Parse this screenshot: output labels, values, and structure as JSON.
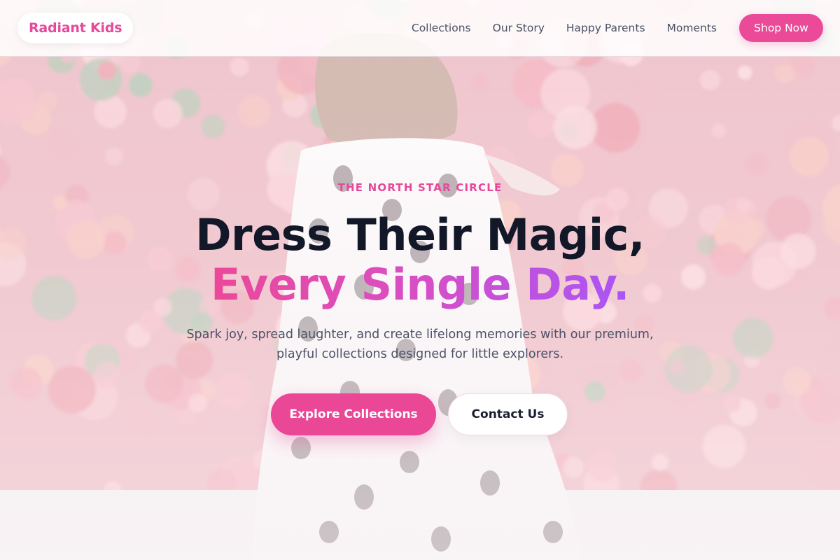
{
  "brand": {
    "name": "Radiant Kids"
  },
  "nav": {
    "links": [
      "Collections",
      "Our Story",
      "Happy Parents",
      "Moments"
    ],
    "cta_label": "Shop Now"
  },
  "hero": {
    "eyebrow": "THE NORTH STAR CIRCLE",
    "headline_line1": "Dress Their Magic,",
    "headline_line2": "Every Single Day.",
    "subtitle": "Spark joy, spread laughter, and create lifelong memories with our premium, playful collections designed for little explorers.",
    "primary_button": "Explore Collections",
    "secondary_button": "Contact Us",
    "background_image": "child-in-polka-dot-dress-against-pink-flowers"
  },
  "colors": {
    "accent": "#ea4a98",
    "gradient_start": "#ec4899",
    "gradient_end": "#a855f7",
    "headline": "#131829",
    "body_text": "#4a5266"
  }
}
